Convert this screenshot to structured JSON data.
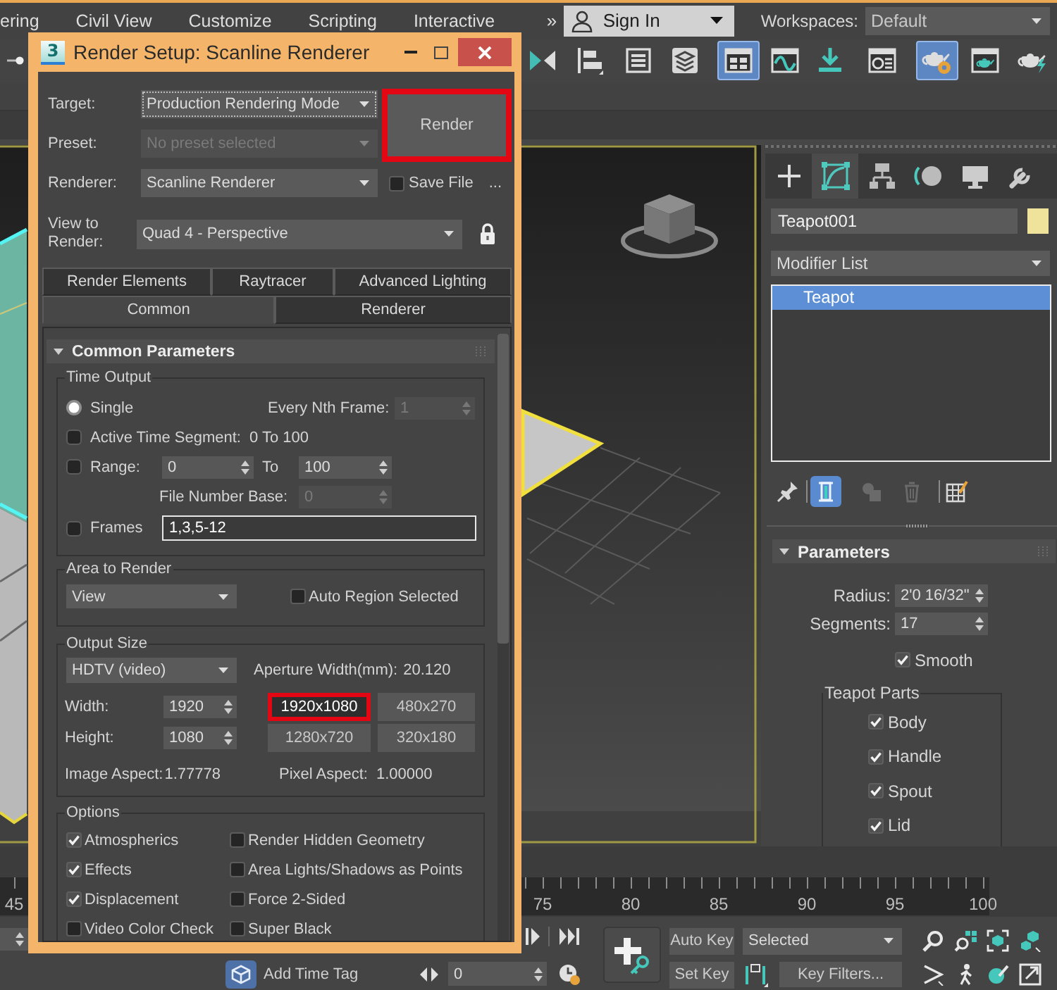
{
  "menu_bar": {
    "items": [
      "ering",
      "Civil View",
      "Customize",
      "Scripting",
      "Interactive"
    ],
    "overflow": "»",
    "sign_in": "Sign In",
    "workspaces": {
      "label": "Workspaces:",
      "value": "Default"
    }
  },
  "toolbar": {
    "buttons": [
      {
        "selected": false
      },
      {
        "selected": false
      },
      {
        "selected": false
      },
      {
        "selected": false
      },
      {
        "selected": false
      },
      {
        "selected": true
      },
      {
        "selected": false
      },
      {
        "selected": false
      },
      {
        "selected": false
      },
      {
        "selected": true
      },
      {
        "selected": false
      },
      {
        "selected": false
      }
    ]
  },
  "render_setup": {
    "logo": "3",
    "title": "Render Setup: Scanline Renderer",
    "fields": [
      {
        "label": "Target:",
        "value": "Production Rendering Mode",
        "disabled": false,
        "focused": true
      },
      {
        "label": "Preset:",
        "value": "No preset selected",
        "disabled": true,
        "focused": false
      },
      {
        "label": "Renderer:",
        "value": "Scanline Renderer",
        "disabled": false,
        "focused": false
      }
    ],
    "render_button": {
      "label": "Render",
      "highlighted": true
    },
    "save_file": {
      "label": "Save File",
      "checked": false
    },
    "browse": "...",
    "view_to_render": {
      "label": "View to Render:",
      "value": "Quad 4 - Perspective"
    },
    "tab_rows": [
      [
        {
          "label": "Render Elements",
          "selected": false
        },
        {
          "label": "Raytracer",
          "selected": false
        },
        {
          "label": "Advanced Lighting",
          "selected": false
        }
      ],
      [
        {
          "label": "Common",
          "selected": true
        },
        {
          "label": "Renderer",
          "selected": false
        }
      ]
    ],
    "rollout": {
      "title": "Common Parameters",
      "expanded": true,
      "time_output": {
        "title": "Time Output",
        "single": {
          "label": "Single",
          "selected": true
        },
        "every_nth_frame": {
          "label": "Every Nth Frame:",
          "value": "1",
          "disabled": true
        },
        "active_time_segment": {
          "label": "Active Time Segment:",
          "selected": false,
          "range": "0 To 100"
        },
        "range": {
          "label": "Range:",
          "selected": false,
          "start": "0",
          "to_label": "To",
          "end": "100"
        },
        "file_number_base": {
          "label": "File Number Base:",
          "value": "0",
          "disabled": true
        },
        "frames": {
          "label": "Frames",
          "selected": false,
          "value": "1,3,5-12"
        }
      },
      "area_to_render": {
        "title": "Area to Render",
        "value": "View",
        "auto_region": {
          "label": "Auto Region Selected",
          "checked": false
        }
      },
      "output_size": {
        "title": "Output Size",
        "format": "HDTV (video)",
        "aperture": {
          "label": "Aperture Width(mm):",
          "value": "20.120"
        },
        "width": {
          "label": "Width:",
          "value": "1920"
        },
        "height": {
          "label": "Height:",
          "value": "1080"
        },
        "presets": [
          {
            "label": "1920x1080",
            "highlighted": true
          },
          {
            "label": "480x270",
            "highlighted": false
          },
          {
            "label": "1280x720",
            "highlighted": false
          },
          {
            "label": "320x180",
            "highlighted": false
          }
        ],
        "image_aspect": {
          "label": "Image Aspect:",
          "value": "1.77778"
        },
        "pixel_aspect": {
          "label": "Pixel Aspect:",
          "value": "1.00000"
        }
      },
      "options": {
        "title": "Options",
        "items": [
          {
            "label": "Atmospherics",
            "checked": true
          },
          {
            "label": "Render Hidden Geometry",
            "checked": false
          },
          {
            "label": "Effects",
            "checked": true
          },
          {
            "label": "Area Lights/Shadows as Points",
            "checked": false
          },
          {
            "label": "Displacement",
            "checked": true
          },
          {
            "label": "Force 2-Sided",
            "checked": false
          },
          {
            "label": "Video Color Check",
            "checked": false
          },
          {
            "label": "Super Black",
            "checked": false
          }
        ]
      }
    }
  },
  "command_panel": {
    "tabs": [
      {
        "selected": false
      },
      {
        "selected": true
      },
      {
        "selected": false
      },
      {
        "selected": false
      },
      {
        "selected": false
      },
      {
        "selected": false
      }
    ],
    "object_name": {
      "value": "Teapot001",
      "color": "#efe39b"
    },
    "modifier_list": "Modifier List",
    "stack": [
      {
        "label": "Teapot",
        "selected": true
      }
    ],
    "stack_tools": [
      {
        "selected": false,
        "disabled": false
      },
      {
        "selected": true,
        "disabled": false
      },
      {
        "selected": false,
        "disabled": true
      },
      {
        "selected": false,
        "disabled": true
      },
      {
        "selected": false,
        "disabled": false
      }
    ],
    "parameters": {
      "title": "Parameters",
      "expanded": true,
      "radius": {
        "label": "Radius:",
        "value": "2'0 16/32\""
      },
      "segments": {
        "label": "Segments:",
        "value": "17"
      },
      "smooth": {
        "label": "Smooth",
        "checked": true
      },
      "teapot_parts": {
        "title": "Teapot Parts",
        "items": [
          {
            "label": "Body",
            "checked": true
          },
          {
            "label": "Handle",
            "checked": true
          },
          {
            "label": "Spout",
            "checked": true
          },
          {
            "label": "Lid",
            "checked": true
          }
        ]
      }
    }
  },
  "time_ruler": {
    "labels": [
      "45",
      "75",
      "80",
      "85",
      "90",
      "95",
      "100"
    ]
  },
  "animation_controls": {
    "add_time_tag": "Add Time Tag",
    "frame": "0",
    "auto_key": {
      "label": "Auto Key",
      "on": false
    },
    "key_mode": "Selected",
    "set_key": "Set Key",
    "key_filters": "Key Filters..."
  }
}
